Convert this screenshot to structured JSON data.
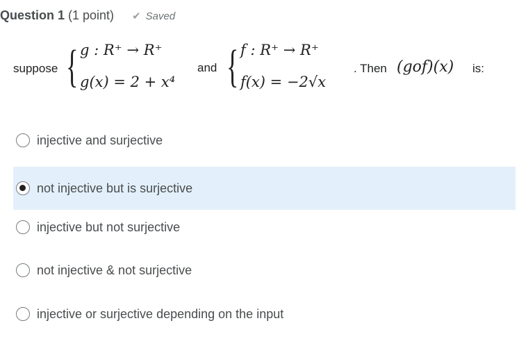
{
  "question": {
    "title": "Question 1",
    "points": "(1 point)",
    "status": "Saved",
    "status_icon": "check-icon"
  },
  "stem": {
    "word_suppose": "suppose",
    "g_line1": "g : R⁺ → R⁺",
    "g_line2": "g(x) = 2 + x⁴",
    "word_and": "and",
    "f_line1": "f : R⁺ → R⁺",
    "f_line2": "f(x) = −2√x",
    "word_then": ". Then",
    "composition": "(gof)(x)",
    "word_is": "is:"
  },
  "options": [
    {
      "label": "injective and surjective",
      "selected": false
    },
    {
      "label": "not injective but is surjective",
      "selected": true
    },
    {
      "label": "injective but not surjective",
      "selected": false
    },
    {
      "label": "not injective & not surjective",
      "selected": false
    },
    {
      "label": "injective or surjective depending on the input",
      "selected": false
    }
  ],
  "colors": {
    "selected_bg": "#e3f0fb",
    "text": "#494c4e"
  }
}
